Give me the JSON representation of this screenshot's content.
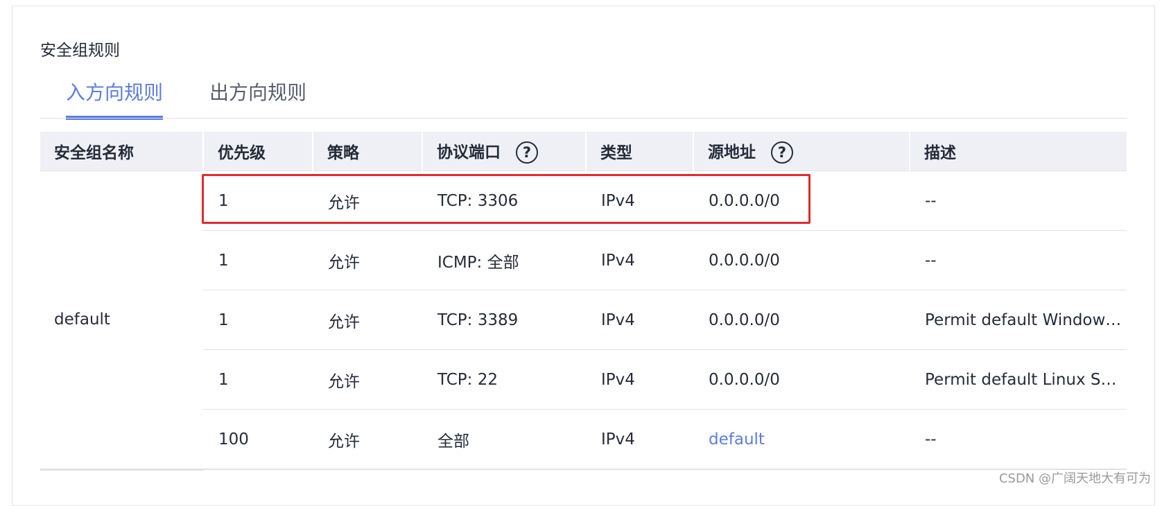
{
  "section": {
    "title": "安全组规则"
  },
  "tabs": [
    {
      "label": "入方向规则",
      "active": true
    },
    {
      "label": "出方向规则",
      "active": false
    }
  ],
  "table": {
    "headers": {
      "group_name": "安全组名称",
      "priority": "优先级",
      "policy": "策略",
      "protocol_port": "协议端口",
      "type": "类型",
      "source": "源地址",
      "description": "描述"
    },
    "group": "default",
    "rows": [
      {
        "priority": "1",
        "policy": "允许",
        "protocol_port": "TCP: 3306",
        "type": "IPv4",
        "source": "0.0.0.0/0",
        "description": "--"
      },
      {
        "priority": "1",
        "policy": "允许",
        "protocol_port": "ICMP: 全部",
        "type": "IPv4",
        "source": "0.0.0.0/0",
        "description": "--"
      },
      {
        "priority": "1",
        "policy": "允许",
        "protocol_port": "TCP: 3389",
        "type": "IPv4",
        "source": "0.0.0.0/0",
        "description": "Permit default Window…"
      },
      {
        "priority": "1",
        "policy": "允许",
        "protocol_port": "TCP: 22",
        "type": "IPv4",
        "source": "0.0.0.0/0",
        "description": "Permit default Linux S…"
      },
      {
        "priority": "100",
        "policy": "允许",
        "protocol_port": "全部",
        "type": "IPv4",
        "source": "default",
        "description": "--"
      }
    ]
  },
  "help_icon_glyph": "?",
  "watermark": "CSDN @广阔天地大有可为",
  "colors": {
    "accent": "#5e7ce0",
    "highlight_border": "#e02b2b",
    "header_bg": "#eef0f5"
  }
}
